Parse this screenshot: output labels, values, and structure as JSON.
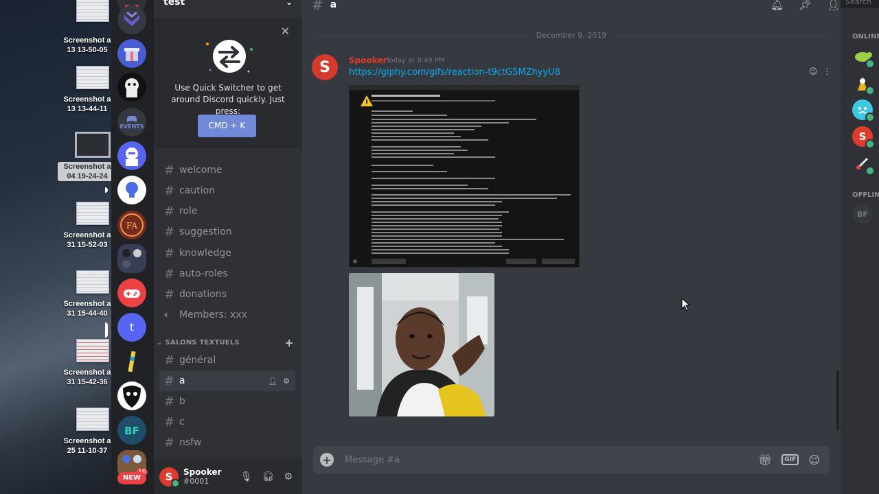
{
  "desktop": {
    "items": [
      {
        "label": "Screenshot a\n13 13-50-05",
        "selected": false
      },
      {
        "label": "Screenshot a\n13 13-44-11",
        "selected": false
      },
      {
        "label": "Screenshot a\n04 19-24-24",
        "selected": true
      },
      {
        "label": "Screenshot a\n31 15-52-03",
        "selected": false
      },
      {
        "label": "Screenshot a\n31 15-44-40",
        "selected": false
      },
      {
        "label": "Screenshot a\n31 15-42-36",
        "selected": false
      },
      {
        "label": "Screenshot a\n25 11-10-37",
        "selected": false
      }
    ]
  },
  "rail": {
    "events_label": "EVENTS",
    "letter_server": "t",
    "new_badge": "NEW",
    "badge_count": "16"
  },
  "sidebar": {
    "server_name": "test",
    "quick_switcher": {
      "text": "Use Quick Switcher to get around Discord quickly. Just press:",
      "button": "CMD + K"
    },
    "channels_top": [
      {
        "name": "welcome",
        "icon": "hash-icon"
      },
      {
        "name": "caution",
        "icon": "hash-icon"
      },
      {
        "name": "role",
        "icon": "hash-icon"
      },
      {
        "name": "suggestion",
        "icon": "hash-icon"
      },
      {
        "name": "knowledge",
        "icon": "hash-icon"
      },
      {
        "name": "auto-roles",
        "icon": "hash-icon"
      },
      {
        "name": "donations",
        "icon": "hash-icon"
      },
      {
        "name": "Members: xxx",
        "icon": "speaker-icon"
      }
    ],
    "category": "SALONS TEXTUELS",
    "channels_bottom": [
      {
        "name": "général",
        "active": false
      },
      {
        "name": "a",
        "active": true
      },
      {
        "name": "b",
        "active": false
      },
      {
        "name": "c",
        "active": false
      },
      {
        "name": "nsfw",
        "active": false
      }
    ],
    "user": {
      "name": "Spooker",
      "tag": "#0001",
      "avatar_letter": "S"
    }
  },
  "chat": {
    "channel": "a",
    "date_divider": "December 9, 2019",
    "message": {
      "author": "Spooker",
      "time": "Today at 8:49 PM",
      "link": "https://giphy.com/gifs/reaction-t9ctG5MZhyyU8",
      "avatar_letter": "S"
    },
    "composer_placeholder": "Message #a",
    "gif_label": "GIF"
  },
  "members": {
    "search_placeholder": "Search",
    "online_header": "ONLINE",
    "offline_header": "OFFLINE",
    "offline_letters": "BF",
    "spooker_letter": "S"
  },
  "colors": {
    "blurple": "#7289da",
    "online": "#43b581",
    "link": "#00b0f4",
    "author": "#e03a2c"
  }
}
